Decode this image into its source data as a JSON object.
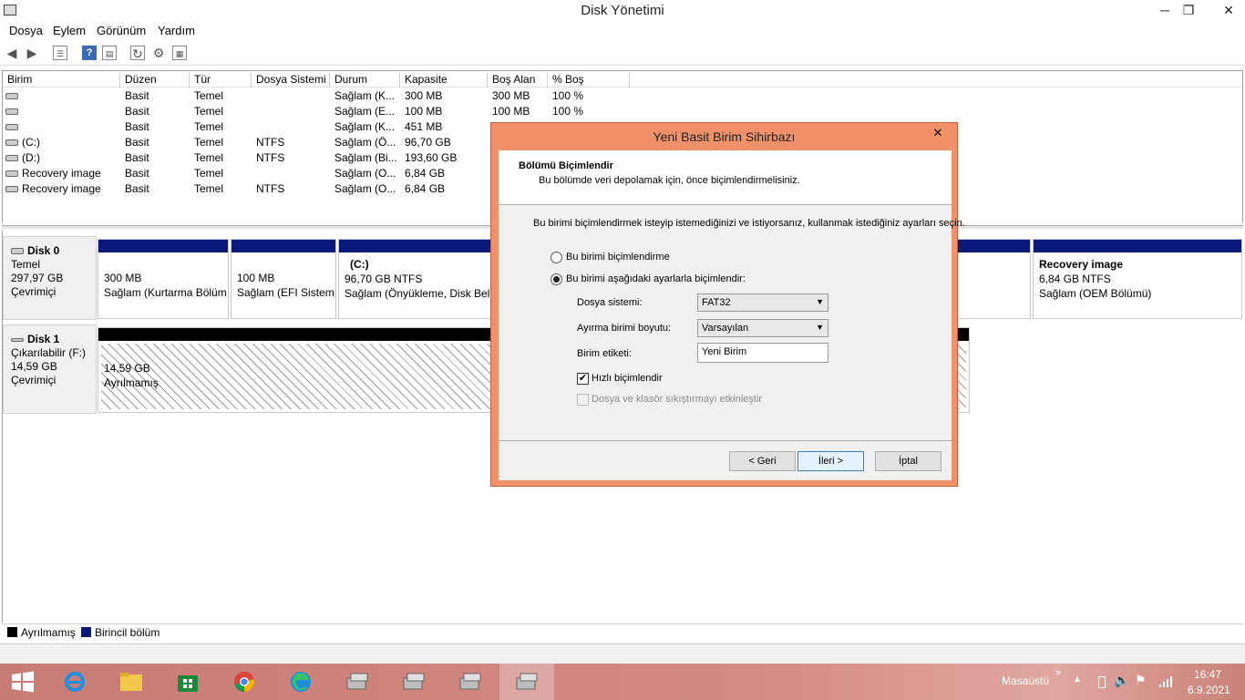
{
  "window": {
    "title": "Disk Yönetimi",
    "minimize": "─",
    "restore": "❐",
    "close": "✕"
  },
  "menu": [
    "Dosya",
    "Eylem",
    "Görünüm",
    "Yardım"
  ],
  "columns": [
    "Birim",
    "Düzen",
    "Tür",
    "Dosya Sistemi",
    "Durum",
    "Kapasite",
    "Boş Alan",
    "% Boş"
  ],
  "volumes": [
    {
      "name": "",
      "layout": "Basit",
      "type": "Temel",
      "fs": "",
      "status": "Sağlam (K...",
      "capacity": "300 MB",
      "free": "300 MB",
      "pct": "100 %"
    },
    {
      "name": "",
      "layout": "Basit",
      "type": "Temel",
      "fs": "",
      "status": "Sağlam (E...",
      "capacity": "100 MB",
      "free": "100 MB",
      "pct": "100 %"
    },
    {
      "name": "",
      "layout": "Basit",
      "type": "Temel",
      "fs": "",
      "status": "Sağlam (K...",
      "capacity": "451 MB",
      "free": "",
      "pct": ""
    },
    {
      "name": "(C:)",
      "layout": "Basit",
      "type": "Temel",
      "fs": "NTFS",
      "status": "Sağlam (Ö...",
      "capacity": "96,70 GB",
      "free": "",
      "pct": ""
    },
    {
      "name": "(D:)",
      "layout": "Basit",
      "type": "Temel",
      "fs": "NTFS",
      "status": "Sağlam (Bi...",
      "capacity": "193,60 GB",
      "free": "",
      "pct": ""
    },
    {
      "name": "Recovery image",
      "layout": "Basit",
      "type": "Temel",
      "fs": "",
      "status": "Sağlam (O...",
      "capacity": "6,84 GB",
      "free": "",
      "pct": ""
    },
    {
      "name": "Recovery image",
      "layout": "Basit",
      "type": "Temel",
      "fs": "NTFS",
      "status": "Sağlam (O...",
      "capacity": "6,84 GB",
      "free": "",
      "pct": ""
    }
  ],
  "disk0": {
    "name": "Disk 0",
    "type": "Temel",
    "size": "297,97 GB",
    "state": "Çevrimiçi",
    "p1": {
      "size": "300 MB",
      "status": "Sağlam (Kurtarma Bölüm"
    },
    "p2": {
      "size": "100 MB",
      "status": "Sağlam (EFI Sistem"
    },
    "p3": {
      "name": "(C:)",
      "size": "96,70 GB NTFS",
      "status": "Sağlam (Önyükleme, Disk Belle"
    },
    "p4": {
      "name": "Recovery image",
      "size": "6,84 GB NTFS",
      "status": "Sağlam (OEM Bölümü)"
    }
  },
  "disk1": {
    "name": "Disk 1",
    "type": "Çıkarılabilir (F:)",
    "size": "14,59 GB",
    "state": "Çevrimiçi",
    "p1": {
      "size": "14,59 GB",
      "status": "Ayrılmamış"
    }
  },
  "legend": [
    {
      "label": "Ayrılmamış",
      "color": "#000000"
    },
    {
      "label": "Birincil bölüm",
      "color": "#0a1a7a"
    }
  ],
  "dialog": {
    "title": "Yeni Basit Birim Sihirbazı",
    "close": "✕",
    "heading": "Bölümü Biçimlendir",
    "subheading": "Bu bölümde veri depolamak için, önce biçimlendirmelisiniz.",
    "instruction": "Bu birimi biçimlendirmek isteyip istemediğinizi ve istiyorsanız, kullanmak istediğiniz ayarları seçin.",
    "radio_no_format": "Bu birimi biçimlendirme",
    "radio_format": "Bu birimi aşağıdaki ayarlarla biçimlendir:",
    "fs_label": "Dosya sistemi:",
    "fs_value": "FAT32",
    "alloc_label": "Ayırma birimi boyutu:",
    "alloc_value": "Varsayılan",
    "volume_label": "Birim etiketi:",
    "volume_value": "Yeni Birim",
    "quick_format": "Hızlı biçimlendir",
    "compression": "Dosya ve klasör sıkıştırmayı etkinleştir",
    "back": "< Geri",
    "next": "İleri >",
    "cancel": "İptal"
  },
  "taskbar": {
    "desktop": "Masaüstü",
    "chevron": "»",
    "time": "16:47",
    "date": "6.9.2021"
  }
}
